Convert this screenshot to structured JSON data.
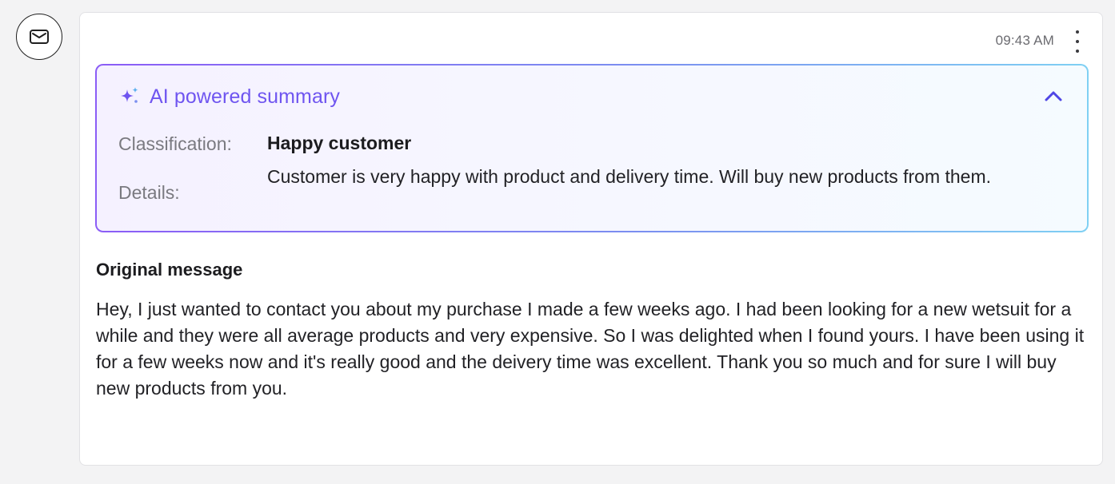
{
  "message": {
    "icon": "mail-icon",
    "timestamp": "09:43 AM",
    "menu_icon": "more-vertical-icon"
  },
  "summary": {
    "icon": "sparkles-icon",
    "title": "AI powered summary",
    "collapse_icon": "chevron-up-icon",
    "classification_label": "Classification:",
    "classification_value": "Happy customer",
    "details_label": "Details:",
    "details_value": "Customer is very happy with product and delivery time. Will buy new products from them."
  },
  "original": {
    "heading": "Original message",
    "body": "Hey, I just wanted to contact you about my purchase I made a few weeks ago. I had been looking for a new wetsuit for a while and they were all average products and very expensive. So I was delighted when I found yours. I have been using it for a few weeks now and it's really good and the deivery time was excellent. Thank you so much and for sure I will buy new products from you."
  },
  "colors": {
    "accent": "#6f55f0",
    "gradient_start": "#8b5cf6",
    "gradient_end": "#7fd0f3",
    "background": "#f3f3f4",
    "card": "#ffffff"
  }
}
